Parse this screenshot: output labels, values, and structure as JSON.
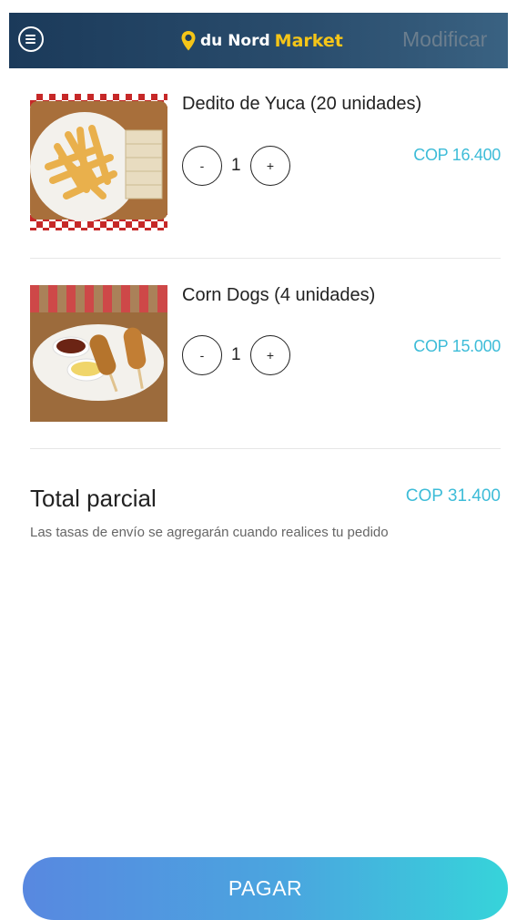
{
  "header": {
    "brand_prefix": "du Nord",
    "brand_suffix": "Market",
    "edit_label": "Modificar",
    "menu_icon": "menu-icon",
    "pin_icon": "location-pin-icon"
  },
  "cart": {
    "items": [
      {
        "name": "Dedito de Yuca (20 unidades)",
        "minus": "-",
        "quantity": "1",
        "plus": "+",
        "price": "COP 16.400"
      },
      {
        "name": "Corn Dogs (4 unidades)",
        "minus": "-",
        "quantity": "1",
        "plus": "+",
        "price": "COP 15.000"
      }
    ]
  },
  "summary": {
    "label": "Total parcial",
    "total": "COP 31.400",
    "note": "Las tasas de envío se agregarán cuando realices tu pedido"
  },
  "checkout": {
    "button_label": "PAGAR"
  },
  "colors": {
    "header_dark": "#1b3a5a",
    "accent": "#3dbcd8",
    "brand_yellow": "#f5c518",
    "pay_gradient_start": "#5888e0",
    "pay_gradient_end": "#36d4da"
  }
}
